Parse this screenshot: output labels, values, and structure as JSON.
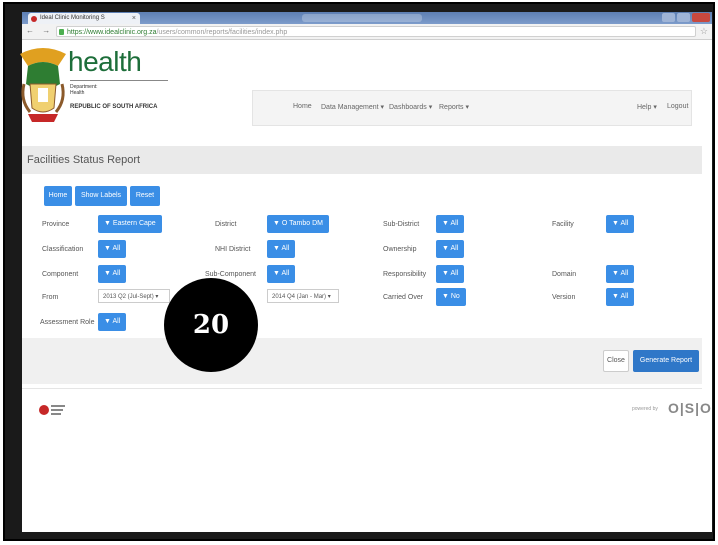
{
  "browser": {
    "tab_title": "Ideal Clinic Monitoring S",
    "tab_close": "×",
    "nav": "← → C ⌂",
    "url_host": "https://www.idealclinic.org.za",
    "url_path": "/users/common/reports/facilities/index.php",
    "star": "☆"
  },
  "brand": {
    "title": "health",
    "department": "Department:\nHealth",
    "republic": "REPUBLIC OF SOUTH AFRICA"
  },
  "topnav": {
    "home": "Home",
    "data_management": "Data Management ▾",
    "dashboards": "Dashboards ▾",
    "reports": "Reports ▾",
    "help": "Help ▾",
    "logout": "Logout"
  },
  "page": {
    "title": "Facilities Status Report"
  },
  "toolbar": {
    "home": "Home",
    "show_labels": "Show Labels",
    "reset": "Reset"
  },
  "filters": {
    "province_label": "Province",
    "province_value": "▼ Eastern Cape",
    "district_label": "District",
    "district_value": "▼ O Tambo DM",
    "subdistrict_label": "Sub-District",
    "subdistrict_value": "▼ All",
    "facility_label": "Facility",
    "facility_value": "▼ All",
    "classification_label": "Classification",
    "classification_value": "▼ All",
    "nhi_label": "NHI District",
    "nhi_value": "▼ All",
    "ownership_label": "Ownership",
    "ownership_value": "▼ All",
    "component_label": "Component",
    "component_value": "▼ All",
    "subcomponent_label": "Sub-Component",
    "subcomponent_value": "▼ All",
    "responsibility_label": "Responsibility",
    "responsibility_value": "▼ All",
    "domain_label": "Domain",
    "domain_value": "▼ All",
    "from_label": "From",
    "from_value": "2013 Q2 (Jul-Sept)",
    "to_value": "2014 Q4 (Jan - Mar)",
    "carried_label": "Carried Over",
    "carried_value": "▼ No",
    "version_label": "Version",
    "version_value": "▼ All",
    "role_label": "Assessment Role",
    "role_value": "▼ All",
    "caret": "▾"
  },
  "actions": {
    "close": "Close",
    "generate": "Generate Report"
  },
  "footer": {
    "powered": "powered by",
    "os": "O|S|O"
  },
  "badge": {
    "number": "20"
  },
  "colors": {
    "accent": "#3a8ee6",
    "brand_green": "#1d6e3a"
  }
}
